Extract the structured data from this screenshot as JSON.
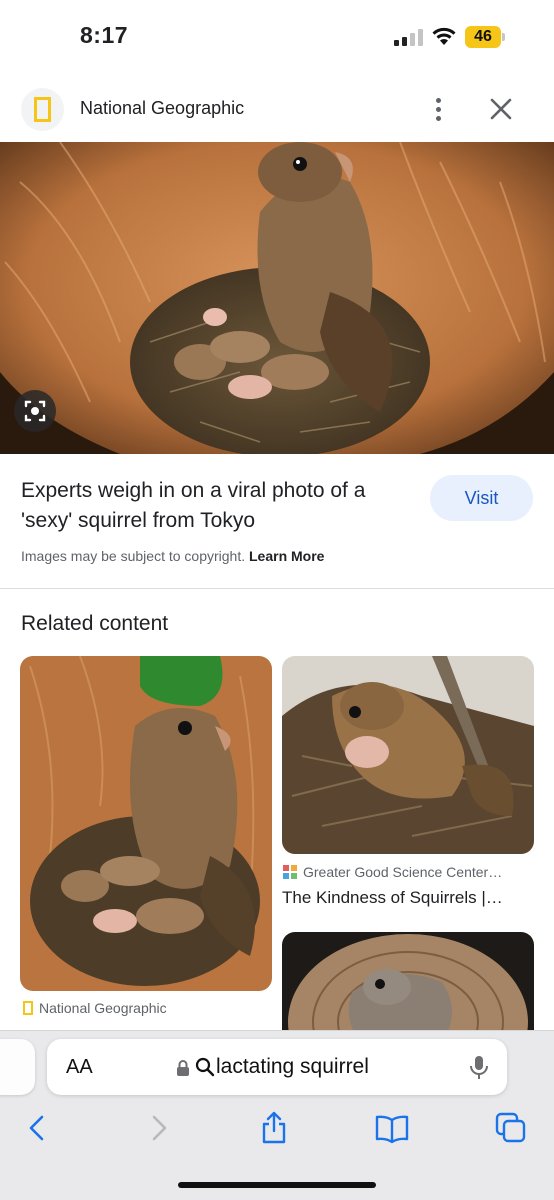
{
  "status_bar": {
    "time": "8:17",
    "battery_level": "46"
  },
  "header": {
    "source_name": "National Geographic"
  },
  "result": {
    "title": "Experts weigh in on a viral photo of a 'sexy' squirrel from Tokyo",
    "visit_label": "Visit",
    "copyright_text": "Images may be subject to copyright.",
    "learn_more_label": "Learn More"
  },
  "related": {
    "heading": "Related content",
    "cards": [
      {
        "source": "National Geographic"
      },
      {
        "source": "Greater Good Science Center…",
        "title": "The Kindness of Squirrels |…"
      },
      {}
    ]
  },
  "browser": {
    "text_size_label": "AA",
    "address_text": "lactating squirrel"
  },
  "colors": {
    "ng_yellow": "#f5c518",
    "visit_bg": "#e8f0fe",
    "visit_text": "#1a56c0",
    "safari_blue": "#1a73e8"
  }
}
